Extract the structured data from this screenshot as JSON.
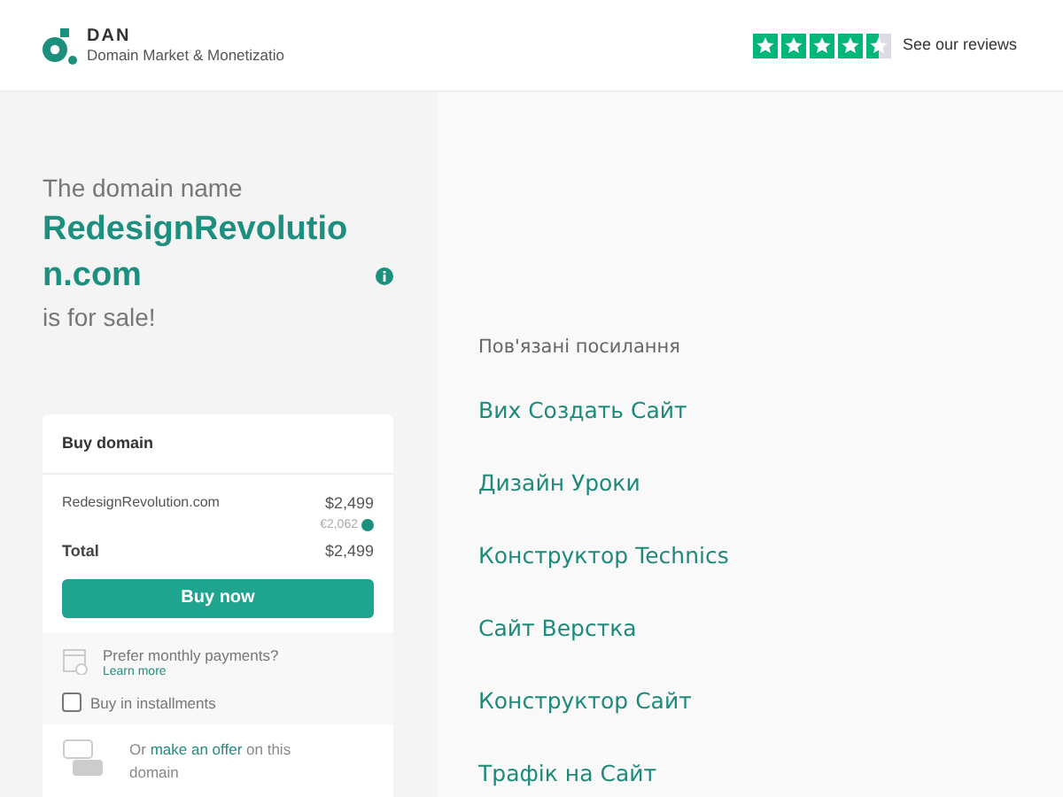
{
  "header": {
    "logo_letters": "DAN",
    "logo_subtitle": "Domain Market & Monetizatio",
    "reviews_link": "See our reviews"
  },
  "intro": {
    "lead": "The domain name",
    "domain": "RedesignRevolution.com",
    "tail": "is for sale!"
  },
  "buy_card": {
    "title": "Buy domain",
    "item": "RedesignRevolution.com",
    "price": "$2,499",
    "price_eur": "€2,062",
    "total_label": "Total",
    "total": "$2,499",
    "buy_button": "Buy now",
    "monthly_prompt": "Prefer monthly payments?",
    "learn_more": "Learn more",
    "installments": {
      "label": "Buy in installments",
      "checked": false
    },
    "offer_before": "Or",
    "offer_link": "make an offer",
    "offer_after": "on this domain"
  },
  "related": {
    "title": "Пов'язані посилання",
    "links": [
      "Вих Создать Сайт",
      "Дизайн Уроки",
      "Конструктор Technics",
      "Сайт Верстка",
      "Конструктор Сайт",
      "Трафік на Сайт"
    ]
  }
}
